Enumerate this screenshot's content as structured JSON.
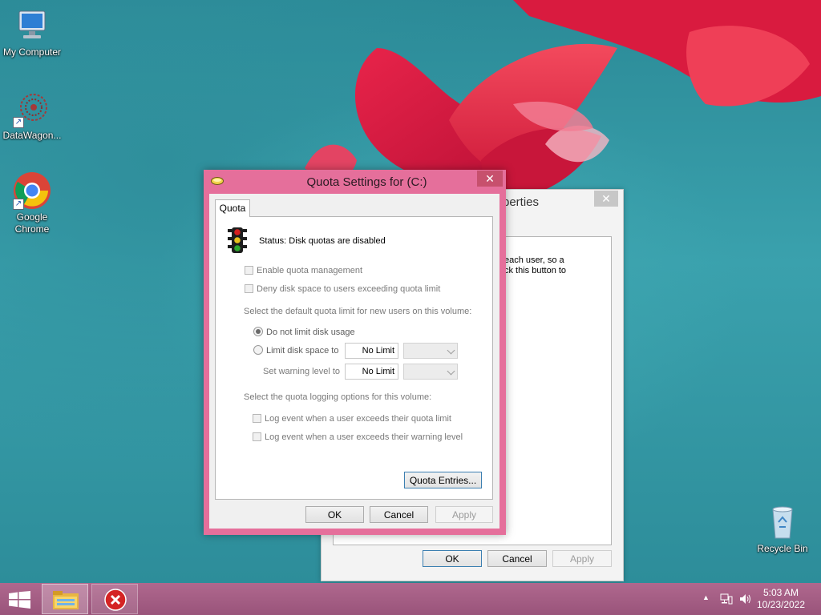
{
  "desktop": {
    "icons": [
      {
        "label": "My Computer"
      },
      {
        "label": "DataWagon..."
      },
      {
        "label": "Google Chrome"
      },
      {
        "label": "Recycle Bin"
      }
    ]
  },
  "back_dialog": {
    "title_fragment": "perties",
    "text_line1": "each user, so a",
    "text_line2": "ck this button to",
    "ok_label": "OK",
    "cancel_label": "Cancel",
    "apply_label": "Apply"
  },
  "quota_dialog": {
    "title": "Quota Settings for  (C:)",
    "tab_label": "Quota",
    "status_text": "Status:  Disk quotas are disabled",
    "enable_quota_label": "Enable quota management",
    "deny_space_label": "Deny disk space to users exceeding quota limit",
    "default_limit_heading": "Select the default quota limit for new users on this volume:",
    "no_limit_radio_label": "Do not limit disk usage",
    "limit_radio_label": "Limit disk space to",
    "limit_value": "No Limit",
    "warning_label": "Set warning level to",
    "warning_value": "No Limit",
    "logging_heading": "Select the quota logging options for this volume:",
    "log_limit_label": "Log event when a user exceeds their quota limit",
    "log_warning_label": "Log event when a user exceeds their warning level",
    "quota_entries_label": "Quota Entries...",
    "ok_label": "OK",
    "cancel_label": "Cancel",
    "apply_label": "Apply"
  },
  "taskbar": {
    "time": "5:03 AM",
    "date": "10/23/2022"
  }
}
